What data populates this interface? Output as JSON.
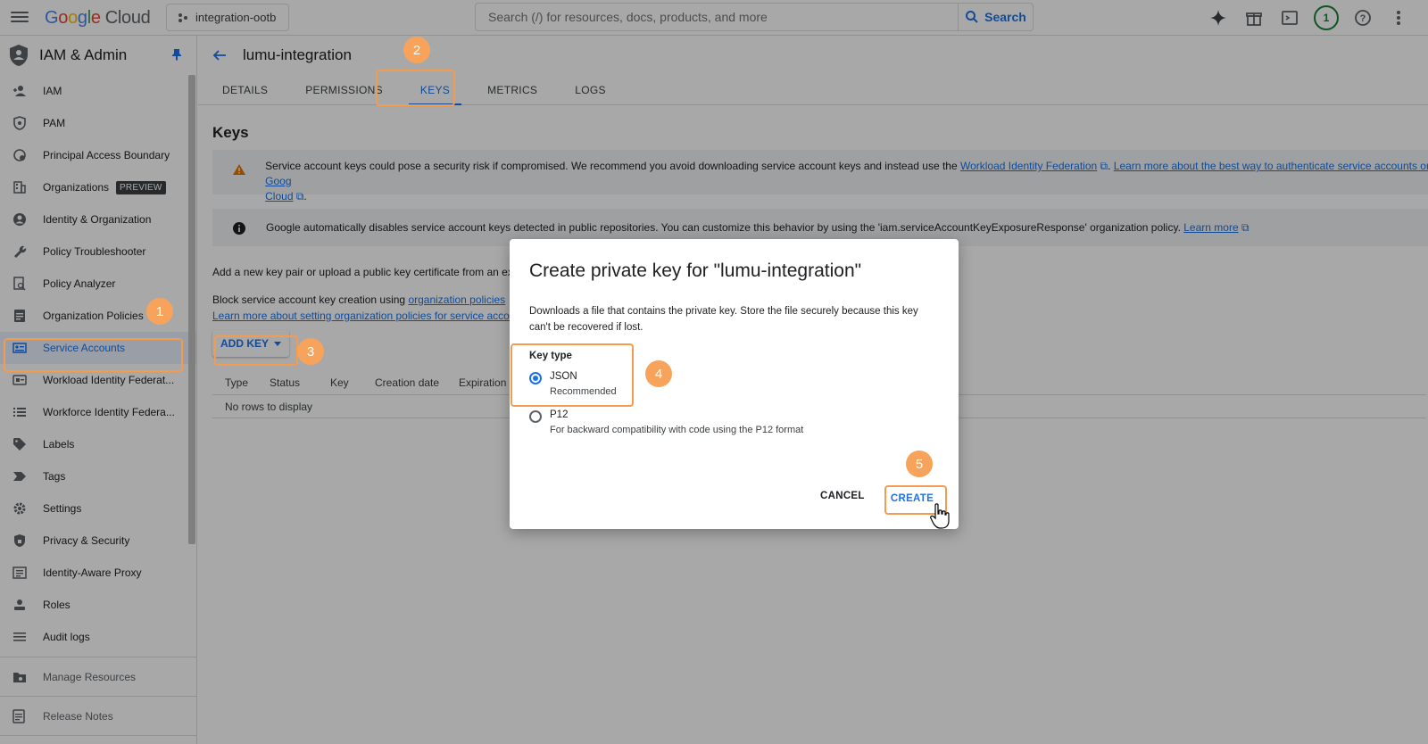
{
  "topbar": {
    "logo_google": [
      "G",
      "o",
      "o",
      "g",
      "l",
      "e"
    ],
    "logo_cloud": "Cloud",
    "project": "integration-ootb",
    "search_placeholder": "Search (/) for resources, docs, products, and more",
    "search_button": "Search",
    "avatar_label": "1"
  },
  "sidebar": {
    "title": "IAM & Admin",
    "items": [
      {
        "label": "IAM",
        "icon": "person-add-icon"
      },
      {
        "label": "PAM",
        "icon": "shield-icon"
      },
      {
        "label": "Principal Access Boundary",
        "icon": "boundary-icon"
      },
      {
        "label": "Organizations",
        "icon": "building-icon",
        "badge": "PREVIEW"
      },
      {
        "label": "Identity & Organization",
        "icon": "account-circle-icon"
      },
      {
        "label": "Policy Troubleshooter",
        "icon": "wrench-icon"
      },
      {
        "label": "Policy Analyzer",
        "icon": "document-search-icon"
      },
      {
        "label": "Organization Policies",
        "icon": "list-box-icon"
      },
      {
        "label": "Service Accounts",
        "icon": "service-account-icon",
        "active": true
      },
      {
        "label": "Workload Identity Federat...",
        "icon": "id-card-icon"
      },
      {
        "label": "Workforce Identity Federa...",
        "icon": "list-icon"
      },
      {
        "label": "Labels",
        "icon": "tag-icon"
      },
      {
        "label": "Tags",
        "icon": "chevron-tag-icon"
      },
      {
        "label": "Settings",
        "icon": "gear-icon"
      },
      {
        "label": "Privacy & Security",
        "icon": "shield-lock-icon"
      },
      {
        "label": "Identity-Aware Proxy",
        "icon": "proxy-icon"
      },
      {
        "label": "Roles",
        "icon": "roles-icon"
      },
      {
        "label": "Audit logs",
        "icon": "lines-icon"
      }
    ],
    "bottom_items": [
      {
        "label": "Manage Resources",
        "icon": "folder-gear-icon"
      },
      {
        "label": "Release Notes",
        "icon": "notes-icon"
      }
    ]
  },
  "page": {
    "title": "lumu-integration",
    "tabs": [
      "DETAILS",
      "PERMISSIONS",
      "KEYS",
      "METRICS",
      "LOGS"
    ],
    "active_tab": "KEYS",
    "section_title": "Keys",
    "warning": {
      "text1": "Service account keys could pose a security risk if compromised. We recommend you avoid downloading service account keys and instead use the ",
      "link1": "Workload Identity Federation",
      "text2": ". ",
      "link2": "Learn more about the best way to authenticate service accounts on Goog",
      "link3": "Cloud",
      "text3": "."
    },
    "info": {
      "text": "Google automatically disables service account keys detected in public repositories. You can customize this behavior by using the 'iam.serviceAccountKeyExposureResponse' organization policy. ",
      "link": "Learn more"
    },
    "desc1": "Add a new key pair or upload a public key certificate from an exi",
    "desc2_text": "Block service account key creation using ",
    "desc2_link": "organization policies",
    "desc3_link": "Learn more about setting organization policies for service accou",
    "add_key": "ADD KEY",
    "table_headers": [
      "Type",
      "Status",
      "Key",
      "Creation date",
      "Expiration da"
    ],
    "empty_text": "No rows to display"
  },
  "dialog": {
    "title": "Create private key for \"lumu-integration\"",
    "description": "Downloads a file that contains the private key. Store the file securely because this key can't be recovered if lost.",
    "key_type_label": "Key type",
    "options": [
      {
        "label": "JSON",
        "sub": "Recommended",
        "checked": true
      },
      {
        "label": "P12",
        "sub": "For backward compatibility with code using the P12 format",
        "checked": false
      }
    ],
    "cancel": "CANCEL",
    "create": "CREATE"
  },
  "callouts": [
    "1",
    "2",
    "3",
    "4",
    "5"
  ],
  "colors": {
    "accent": "#1a73e8",
    "callout": "#f39c50",
    "badge": "#f7a35c"
  }
}
